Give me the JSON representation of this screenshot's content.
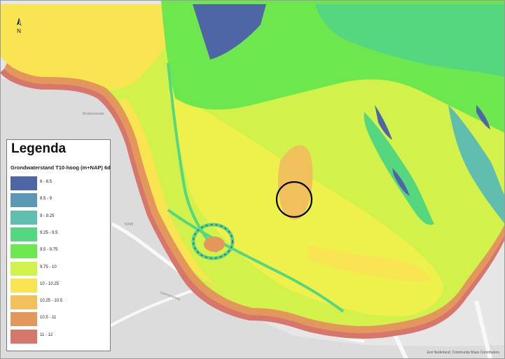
{
  "legend": {
    "title": "Legenda",
    "subtitle": "Grondwaterstand T10-hoog (m+NAP) 6d",
    "classes": [
      {
        "label": "8 - 8.5",
        "color": "#4f66a6"
      },
      {
        "label": "8.5 - 9",
        "color": "#5b98b5"
      },
      {
        "label": "9 - 9.25",
        "color": "#5fbeae"
      },
      {
        "label": "9.25 - 9.5",
        "color": "#55d77f"
      },
      {
        "label": "9.5 - 9.75",
        "color": "#6ce74d"
      },
      {
        "label": "9.75 - 10",
        "color": "#d3f14b"
      },
      {
        "label": "10 - 10.25",
        "color": "#f9e451"
      },
      {
        "label": "10.25 - 10.5",
        "color": "#f0c05a"
      },
      {
        "label": "10.5 - 11",
        "color": "#e3975b"
      },
      {
        "label": "11 - 12",
        "color": "#d7776c"
      }
    ]
  },
  "map": {
    "north_label": "N",
    "attribution": "Esri Nederland, Community Maps Contributors",
    "road_labels": [
      "Broekerweide",
      "Leemansweg",
      "N348"
    ],
    "colors": {
      "basemap": "#e6e6e6",
      "roads": "#f8f8f8",
      "highlight_circle": "#000000"
    }
  }
}
